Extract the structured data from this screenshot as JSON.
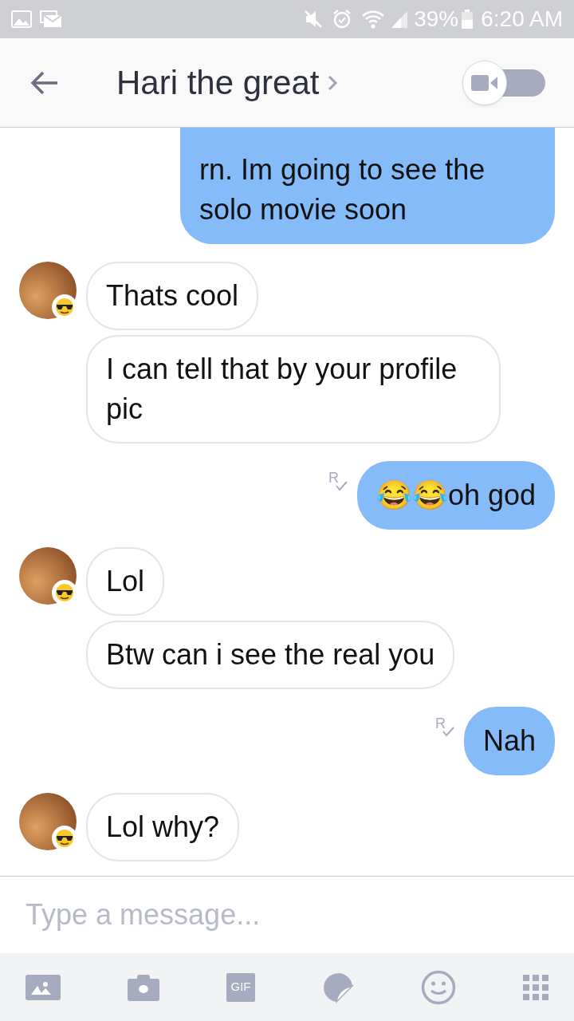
{
  "status_bar": {
    "battery": "39%",
    "time": "6:20 AM"
  },
  "header": {
    "title": "Hari the great",
    "video_toggle": {
      "on": false
    }
  },
  "groups": [
    {
      "kind": "sent",
      "messages": [
        {
          "text": "rn. Im going to see the solo movie soon",
          "clipped_top": true
        }
      ]
    },
    {
      "kind": "received",
      "messages": [
        {
          "text": "Thats cool",
          "clipped_top": false
        },
        {
          "text": "I can tell that by your profile pic",
          "clipped_top": false
        }
      ]
    },
    {
      "kind": "sent",
      "receipt": "R",
      "messages": [
        {
          "text": "😂😂oh god",
          "clipped_top": false
        }
      ]
    },
    {
      "kind": "received",
      "messages": [
        {
          "text": "Lol",
          "clipped_top": false
        },
        {
          "text": "Btw can i see the real you",
          "clipped_top": false
        }
      ]
    },
    {
      "kind": "sent",
      "receipt": "R",
      "messages": [
        {
          "text": "Nah",
          "clipped_top": false
        }
      ]
    },
    {
      "kind": "received",
      "messages": [
        {
          "text": "Lol why?",
          "clipped_top": false
        }
      ]
    }
  ],
  "composer": {
    "placeholder": "Type a message..."
  },
  "toolbar": {
    "gif_label": "GIF"
  }
}
